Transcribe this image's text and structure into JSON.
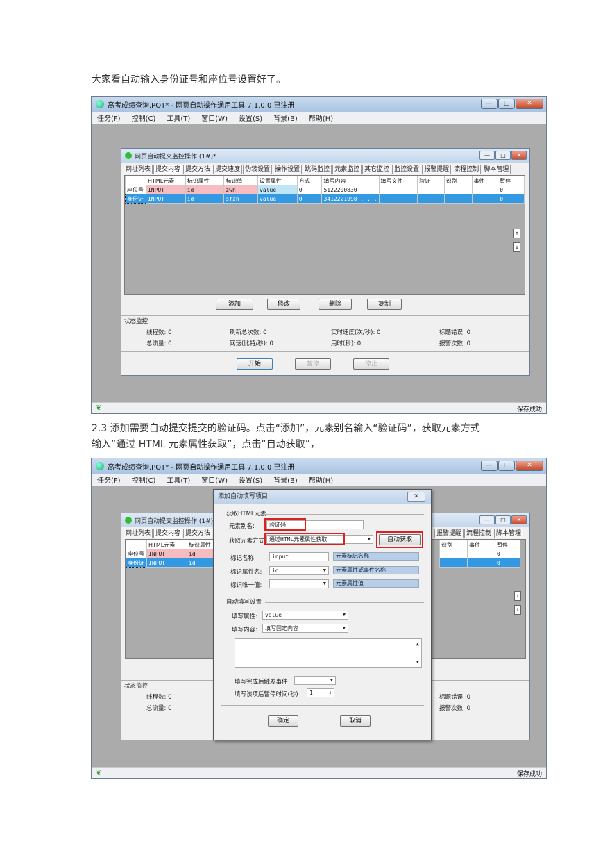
{
  "para1": "大家看自动输入身份证号和座位号设置好了。",
  "para2_line1": "2.3 添加需要自动提交提交的验证码。点击“添加”，元素别名输入“验证码”，获取元素方式",
  "para2_line2": "输入“通过 HTML 元素属性获取”，点击“自动获取”，",
  "app": {
    "title": "高考成绩查询.POT* - 网页自动操作通用工具 7.1.0.0 已注册",
    "window_buttons": [
      "—",
      "□",
      "✕"
    ],
    "menu": [
      "任务(F)",
      "控制(C)",
      "工具(T)",
      "窗口(W)",
      "设置(S)",
      "背景(B)",
      "帮助(H)"
    ],
    "status_text": "保存成功"
  },
  "child": {
    "title": "网页自动提交监控操作 (1#)*",
    "window_buttons": [
      "—",
      "□",
      "✕"
    ],
    "tabs": [
      "网址列表",
      "提交内容",
      "提交方法",
      "提交速度",
      "伪装设置",
      "操作设置",
      "跳码监控",
      "元素监控",
      "其它监控",
      "监控设置",
      "报警提醒",
      "流程控制",
      "脚本管理"
    ],
    "columns": [
      "HTML元素",
      "标识属性",
      "标识值",
      "设置属性",
      "方式",
      "填写内容",
      "填写文件",
      "验证",
      "识别",
      "事件",
      "暂停"
    ],
    "rows": [
      {
        "name": "座位号",
        "cells": [
          "INPUT",
          "id",
          "zwh",
          "value",
          "0",
          "5122200830",
          "",
          "",
          "",
          "",
          "0"
        ]
      },
      {
        "name": "身份证",
        "cells": [
          "INPUT",
          "id",
          "sfzh",
          "value",
          "0",
          "3412221998 . . .",
          "",
          "",
          "",
          "",
          "0"
        ]
      }
    ],
    "scroll_up": "↑",
    "scroll_down": "↓",
    "buttons": {
      "add": "添加",
      "edit": "修改",
      "delete": "删除",
      "copy": "复制"
    },
    "status_label": "状态监控",
    "stats": {
      "threads": "线程数:  0",
      "refresh": "刷新总次数:  0",
      "speed": "实时速度(次/秒):  0",
      "title_err": "标题错误:  0",
      "flow": "总流量:  0",
      "netspeed": "网速(比特/秒):  0",
      "time": "用时(秒):  0",
      "alarms": "报警次数:  0"
    },
    "ctrl": {
      "start": "开始",
      "pause": "暂停",
      "stop": "停止"
    }
  },
  "screen2": {
    "partial_tabs": [
      "网址列表",
      "提交内容",
      "提交方法"
    ],
    "right_tabs": [
      "报警提醒",
      "流程控制",
      "脚本管理"
    ],
    "columns_left": [
      "HTML元素",
      "标识属性"
    ],
    "columns_right": [
      "识别",
      "事件",
      "暂停"
    ],
    "stats_left": [
      "线程数:  0",
      "总流量:  0"
    ],
    "stats_right": [
      "标题错误:  0",
      "报警次数:  0"
    ]
  },
  "dialog": {
    "title": "添加自动填写项目",
    "close": "✕",
    "group1": "获取HTML元素",
    "alias_label": "元素别名:",
    "alias_value": "验证码",
    "method_label": "获取元素方式",
    "method_value": "通过HTML元素属性获取",
    "auto_button": "自动获取",
    "tagname_label": "标记名称:",
    "tagname_value": "input",
    "tagname_hint": "元素标记名称",
    "attrname_label": "标识属性名:",
    "attrname_value": "id",
    "attrname_hint": "元素属性或事件名称",
    "unique_label": "标识唯一值:",
    "unique_value": "",
    "unique_hint": "元素属性值",
    "group2": "自动填写设置",
    "fill_attr_label": "填写属性:",
    "fill_attr_value": "value",
    "fill_content_label": "填写内容:",
    "fill_content_value": "填写固定内容",
    "trigger_label": "填写完成后触发事件",
    "pause_label": "填写该项后暂停时间(秒)",
    "pause_value": "1",
    "ok": "确定",
    "cancel": "取消"
  }
}
